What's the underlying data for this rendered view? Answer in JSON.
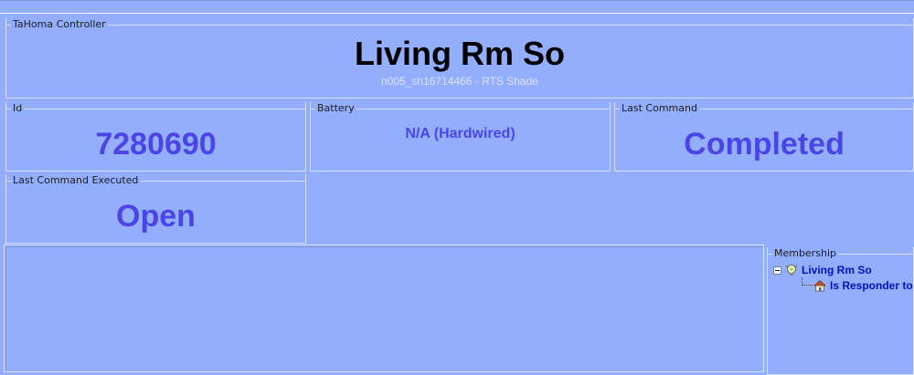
{
  "controller": {
    "legend": "TaHoma Controller",
    "device_name": "Living Rm So",
    "device_subtitle": "n005_sh16714466 - RTS Shade"
  },
  "fields": {
    "id": {
      "legend": "Id",
      "value": "7280690"
    },
    "battery": {
      "legend": "Battery",
      "value": "N/A (Hardwired)"
    },
    "last_command": {
      "legend": "Last Command",
      "value": "Completed"
    },
    "last_command_executed": {
      "legend": "Last Command Executed",
      "value": "Open"
    }
  },
  "membership": {
    "legend": "Membership",
    "tree": [
      {
        "label": "Living Rm So",
        "icon": "scene-bulb-icon",
        "expanded": true
      },
      {
        "label": "Is Responder to",
        "icon": "house-icon"
      }
    ]
  },
  "colors": {
    "background": "#93aefd",
    "value_text": "#4b45e8",
    "tree_text": "#0a0ec0"
  }
}
